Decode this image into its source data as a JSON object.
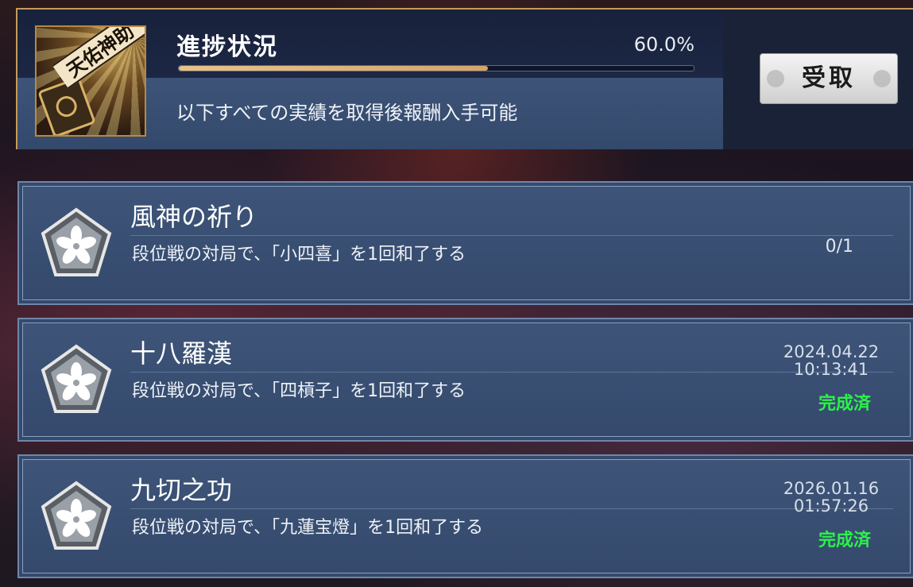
{
  "header": {
    "emblem_text": "天佑神助",
    "progress_title": "進捗状況",
    "progress_percent_label": "60.0%",
    "progress_fraction": 0.6,
    "description": "以下すべての実績を取得後報酬入手可能",
    "claim_button": "受取"
  },
  "achievements": [
    {
      "title": "風神の祈り",
      "description": "段位戦の対局で、「小四喜」を1回和了する",
      "progress": "0/1"
    },
    {
      "title": "十八羅漢",
      "description": "段位戦の対局で、「四槓子」を1回和了する",
      "date": "2024.04.22",
      "time": "10:13:41",
      "status": "完成済"
    },
    {
      "title": "九切之功",
      "description": "段位戦の対局で、「九蓮宝燈」を1回和了する",
      "date": "2026.01.16",
      "time": "01:57:26",
      "status": "完成済"
    }
  ],
  "colors": {
    "gold_border": "#c79b5a",
    "progress_fill": "#e0b87e",
    "completed_status": "#2cf04a",
    "row_bg": "#3b5276"
  },
  "icons": {
    "achievement_badge": "sakura-pentagon-badge-icon",
    "claim_decoration": "sakura-flower-icon"
  }
}
